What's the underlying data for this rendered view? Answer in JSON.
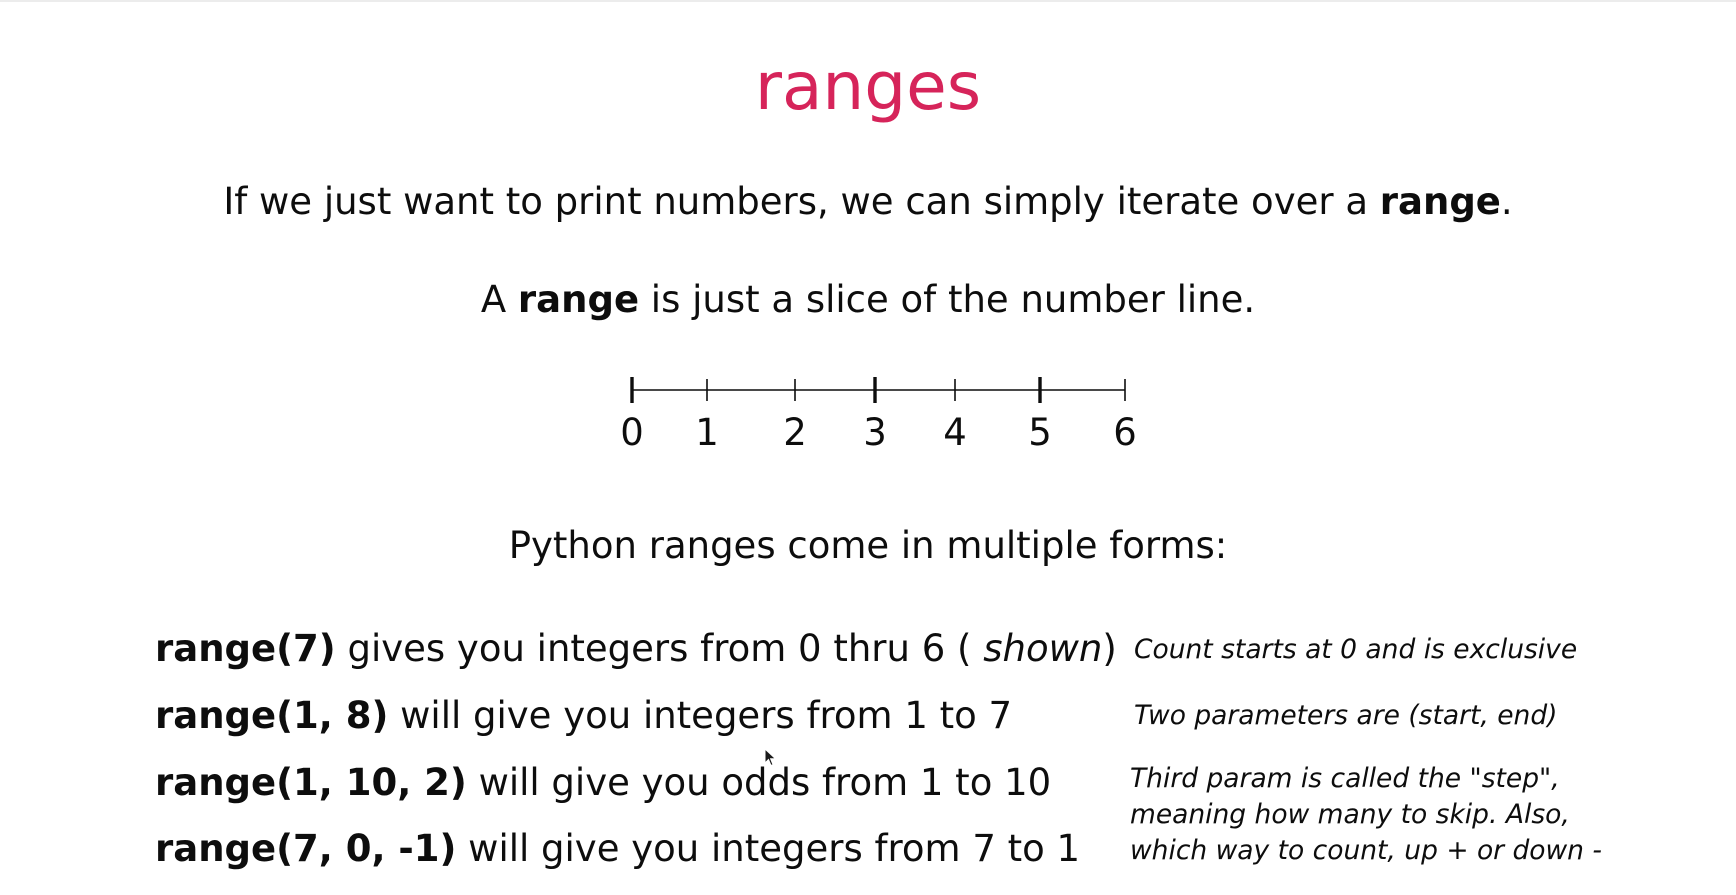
{
  "slide": {
    "title": "ranges",
    "intro": {
      "before": "If we just want to print numbers, we can simply iterate over a ",
      "bold": "range",
      "after": "."
    },
    "definition": {
      "before": "A ",
      "bold": "range",
      "after": " is just a slice of the number line."
    },
    "number_line": {
      "labels": [
        "0",
        "1",
        "2",
        "3",
        "4",
        "5",
        "6"
      ]
    },
    "forms_heading": "Python ranges come in multiple forms:",
    "forms": [
      {
        "code": "range(7)",
        "text_before": " gives you integers from 0 thru 6 ( ",
        "text_italic": "shown",
        "text_after": ")"
      },
      {
        "code": "range(1, 8)",
        "text": " will give you integers from 1 to 7"
      },
      {
        "code": "range(1, 10, 2)",
        "text": "  will give you odds from 1 to 10"
      },
      {
        "code": "range(7, 0, -1)",
        "text": "  will give you integers from 7 to 1"
      }
    ],
    "notes": {
      "count_starts": "Count starts at 0 and is exclusive",
      "two_params": "Two parameters are (start, end)",
      "step_lines": [
        "Third param is called the \"step\",",
        "meaning how many to skip. Also,",
        "which way to count, up + or down -"
      ]
    }
  }
}
